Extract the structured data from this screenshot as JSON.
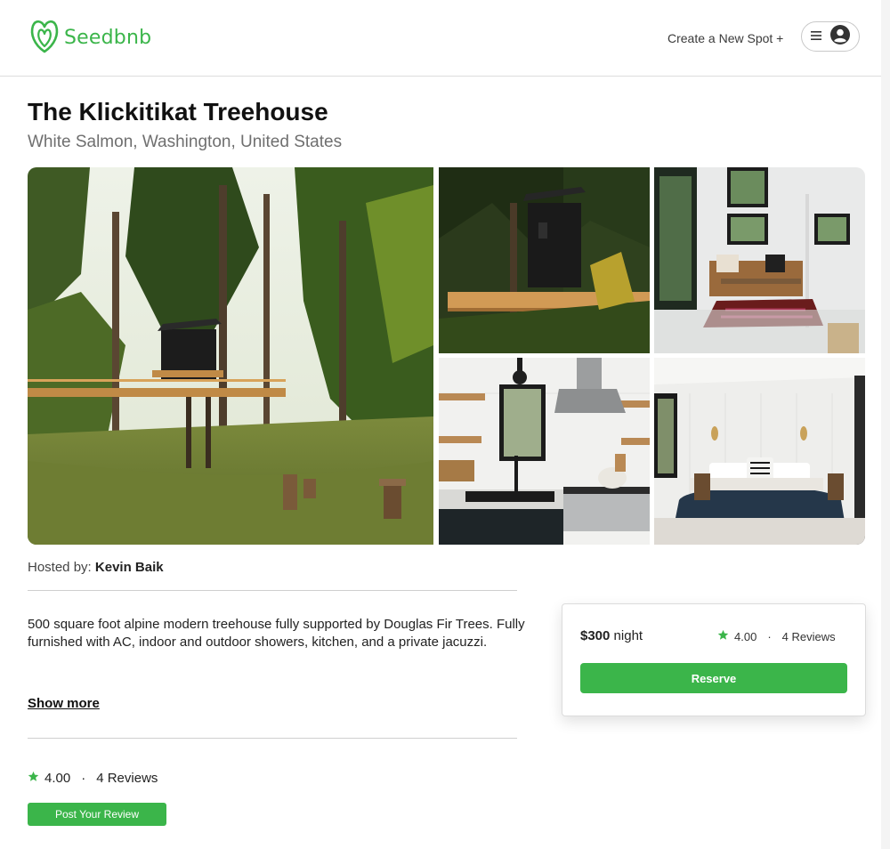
{
  "header": {
    "brand": "Seedbnb",
    "create_spot": "Create a New Spot +",
    "brand_color": "#3bb54a"
  },
  "spot": {
    "name": "The Klickitikat Treehouse",
    "location": "White Salmon, Washington, United States",
    "hosted_label": "Hosted by:",
    "host_name": "Kevin Baik",
    "description": "500 square foot alpine modern treehouse fully supported by Douglas Fir Trees. Fully furnished with AC, indoor and outdoor showers, kitchen, and a private jacuzzi.",
    "show_more": "Show more"
  },
  "gallery": {
    "images": [
      {
        "name": "main-image-treehouse-exterior",
        "alt": "Treehouse among tall fir trees"
      },
      {
        "name": "image-treehouse-deck",
        "alt": "Treehouse deck at dusk"
      },
      {
        "name": "image-living-room",
        "alt": "Living room with leather sofa"
      },
      {
        "name": "image-kitchen",
        "alt": "Kitchen with stove and sink"
      },
      {
        "name": "image-bedroom",
        "alt": "Bedroom with blue bedding"
      }
    ]
  },
  "booking": {
    "price": "$300",
    "price_unit": "night",
    "rating": "4.00",
    "reviews": "4 Reviews",
    "reserve_label": "Reserve"
  },
  "reviews_section": {
    "rating": "4.00",
    "reviews": "4 Reviews",
    "post_label": "Post Your Review"
  },
  "icons": {
    "star": "star-icon",
    "menu": "hamburger-icon",
    "profile": "user-circle-icon",
    "logo": "seed-logo-icon"
  }
}
